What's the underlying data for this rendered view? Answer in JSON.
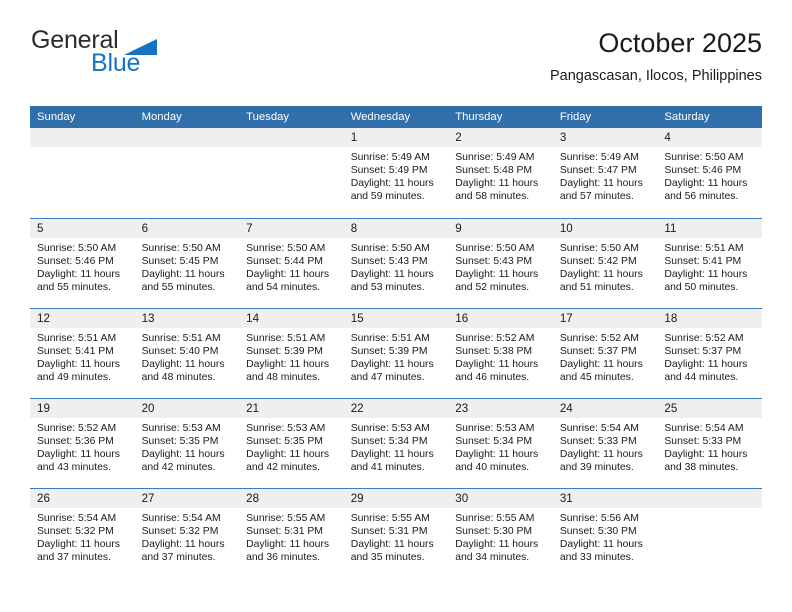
{
  "brand": {
    "name_part1": "General",
    "name_part2": "Blue",
    "accent_color": "#1573c1"
  },
  "header": {
    "title": "October 2025",
    "subtitle": "Pangascasan, Ilocos, Philippines"
  },
  "theme": {
    "header_row_bg": "#316fab",
    "daynum_bg": "#efefef",
    "row_divider": "#3b7ebf"
  },
  "calendar": {
    "weekdays": [
      "Sunday",
      "Monday",
      "Tuesday",
      "Wednesday",
      "Thursday",
      "Friday",
      "Saturday"
    ],
    "weeks": [
      [
        {
          "day": "",
          "sunrise": "",
          "sunset": "",
          "daylight_line1": "",
          "daylight_line2": "",
          "blank": true
        },
        {
          "day": "",
          "sunrise": "",
          "sunset": "",
          "daylight_line1": "",
          "daylight_line2": "",
          "blank": true
        },
        {
          "day": "",
          "sunrise": "",
          "sunset": "",
          "daylight_line1": "",
          "daylight_line2": "",
          "blank": true
        },
        {
          "day": "1",
          "sunrise": "Sunrise: 5:49 AM",
          "sunset": "Sunset: 5:49 PM",
          "daylight_line1": "Daylight: 11 hours",
          "daylight_line2": "and 59 minutes.",
          "blank": false
        },
        {
          "day": "2",
          "sunrise": "Sunrise: 5:49 AM",
          "sunset": "Sunset: 5:48 PM",
          "daylight_line1": "Daylight: 11 hours",
          "daylight_line2": "and 58 minutes.",
          "blank": false
        },
        {
          "day": "3",
          "sunrise": "Sunrise: 5:49 AM",
          "sunset": "Sunset: 5:47 PM",
          "daylight_line1": "Daylight: 11 hours",
          "daylight_line2": "and 57 minutes.",
          "blank": false
        },
        {
          "day": "4",
          "sunrise": "Sunrise: 5:50 AM",
          "sunset": "Sunset: 5:46 PM",
          "daylight_line1": "Daylight: 11 hours",
          "daylight_line2": "and 56 minutes.",
          "blank": false
        }
      ],
      [
        {
          "day": "5",
          "sunrise": "Sunrise: 5:50 AM",
          "sunset": "Sunset: 5:46 PM",
          "daylight_line1": "Daylight: 11 hours",
          "daylight_line2": "and 55 minutes.",
          "blank": false
        },
        {
          "day": "6",
          "sunrise": "Sunrise: 5:50 AM",
          "sunset": "Sunset: 5:45 PM",
          "daylight_line1": "Daylight: 11 hours",
          "daylight_line2": "and 55 minutes.",
          "blank": false
        },
        {
          "day": "7",
          "sunrise": "Sunrise: 5:50 AM",
          "sunset": "Sunset: 5:44 PM",
          "daylight_line1": "Daylight: 11 hours",
          "daylight_line2": "and 54 minutes.",
          "blank": false
        },
        {
          "day": "8",
          "sunrise": "Sunrise: 5:50 AM",
          "sunset": "Sunset: 5:43 PM",
          "daylight_line1": "Daylight: 11 hours",
          "daylight_line2": "and 53 minutes.",
          "blank": false
        },
        {
          "day": "9",
          "sunrise": "Sunrise: 5:50 AM",
          "sunset": "Sunset: 5:43 PM",
          "daylight_line1": "Daylight: 11 hours",
          "daylight_line2": "and 52 minutes.",
          "blank": false
        },
        {
          "day": "10",
          "sunrise": "Sunrise: 5:50 AM",
          "sunset": "Sunset: 5:42 PM",
          "daylight_line1": "Daylight: 11 hours",
          "daylight_line2": "and 51 minutes.",
          "blank": false
        },
        {
          "day": "11",
          "sunrise": "Sunrise: 5:51 AM",
          "sunset": "Sunset: 5:41 PM",
          "daylight_line1": "Daylight: 11 hours",
          "daylight_line2": "and 50 minutes.",
          "blank": false
        }
      ],
      [
        {
          "day": "12",
          "sunrise": "Sunrise: 5:51 AM",
          "sunset": "Sunset: 5:41 PM",
          "daylight_line1": "Daylight: 11 hours",
          "daylight_line2": "and 49 minutes.",
          "blank": false
        },
        {
          "day": "13",
          "sunrise": "Sunrise: 5:51 AM",
          "sunset": "Sunset: 5:40 PM",
          "daylight_line1": "Daylight: 11 hours",
          "daylight_line2": "and 48 minutes.",
          "blank": false
        },
        {
          "day": "14",
          "sunrise": "Sunrise: 5:51 AM",
          "sunset": "Sunset: 5:39 PM",
          "daylight_line1": "Daylight: 11 hours",
          "daylight_line2": "and 48 minutes.",
          "blank": false
        },
        {
          "day": "15",
          "sunrise": "Sunrise: 5:51 AM",
          "sunset": "Sunset: 5:39 PM",
          "daylight_line1": "Daylight: 11 hours",
          "daylight_line2": "and 47 minutes.",
          "blank": false
        },
        {
          "day": "16",
          "sunrise": "Sunrise: 5:52 AM",
          "sunset": "Sunset: 5:38 PM",
          "daylight_line1": "Daylight: 11 hours",
          "daylight_line2": "and 46 minutes.",
          "blank": false
        },
        {
          "day": "17",
          "sunrise": "Sunrise: 5:52 AM",
          "sunset": "Sunset: 5:37 PM",
          "daylight_line1": "Daylight: 11 hours",
          "daylight_line2": "and 45 minutes.",
          "blank": false
        },
        {
          "day": "18",
          "sunrise": "Sunrise: 5:52 AM",
          "sunset": "Sunset: 5:37 PM",
          "daylight_line1": "Daylight: 11 hours",
          "daylight_line2": "and 44 minutes.",
          "blank": false
        }
      ],
      [
        {
          "day": "19",
          "sunrise": "Sunrise: 5:52 AM",
          "sunset": "Sunset: 5:36 PM",
          "daylight_line1": "Daylight: 11 hours",
          "daylight_line2": "and 43 minutes.",
          "blank": false
        },
        {
          "day": "20",
          "sunrise": "Sunrise: 5:53 AM",
          "sunset": "Sunset: 5:35 PM",
          "daylight_line1": "Daylight: 11 hours",
          "daylight_line2": "and 42 minutes.",
          "blank": false
        },
        {
          "day": "21",
          "sunrise": "Sunrise: 5:53 AM",
          "sunset": "Sunset: 5:35 PM",
          "daylight_line1": "Daylight: 11 hours",
          "daylight_line2": "and 42 minutes.",
          "blank": false
        },
        {
          "day": "22",
          "sunrise": "Sunrise: 5:53 AM",
          "sunset": "Sunset: 5:34 PM",
          "daylight_line1": "Daylight: 11 hours",
          "daylight_line2": "and 41 minutes.",
          "blank": false
        },
        {
          "day": "23",
          "sunrise": "Sunrise: 5:53 AM",
          "sunset": "Sunset: 5:34 PM",
          "daylight_line1": "Daylight: 11 hours",
          "daylight_line2": "and 40 minutes.",
          "blank": false
        },
        {
          "day": "24",
          "sunrise": "Sunrise: 5:54 AM",
          "sunset": "Sunset: 5:33 PM",
          "daylight_line1": "Daylight: 11 hours",
          "daylight_line2": "and 39 minutes.",
          "blank": false
        },
        {
          "day": "25",
          "sunrise": "Sunrise: 5:54 AM",
          "sunset": "Sunset: 5:33 PM",
          "daylight_line1": "Daylight: 11 hours",
          "daylight_line2": "and 38 minutes.",
          "blank": false
        }
      ],
      [
        {
          "day": "26",
          "sunrise": "Sunrise: 5:54 AM",
          "sunset": "Sunset: 5:32 PM",
          "daylight_line1": "Daylight: 11 hours",
          "daylight_line2": "and 37 minutes.",
          "blank": false
        },
        {
          "day": "27",
          "sunrise": "Sunrise: 5:54 AM",
          "sunset": "Sunset: 5:32 PM",
          "daylight_line1": "Daylight: 11 hours",
          "daylight_line2": "and 37 minutes.",
          "blank": false
        },
        {
          "day": "28",
          "sunrise": "Sunrise: 5:55 AM",
          "sunset": "Sunset: 5:31 PM",
          "daylight_line1": "Daylight: 11 hours",
          "daylight_line2": "and 36 minutes.",
          "blank": false
        },
        {
          "day": "29",
          "sunrise": "Sunrise: 5:55 AM",
          "sunset": "Sunset: 5:31 PM",
          "daylight_line1": "Daylight: 11 hours",
          "daylight_line2": "and 35 minutes.",
          "blank": false
        },
        {
          "day": "30",
          "sunrise": "Sunrise: 5:55 AM",
          "sunset": "Sunset: 5:30 PM",
          "daylight_line1": "Daylight: 11 hours",
          "daylight_line2": "and 34 minutes.",
          "blank": false
        },
        {
          "day": "31",
          "sunrise": "Sunrise: 5:56 AM",
          "sunset": "Sunset: 5:30 PM",
          "daylight_line1": "Daylight: 11 hours",
          "daylight_line2": "and 33 minutes.",
          "blank": false
        },
        {
          "day": "",
          "sunrise": "",
          "sunset": "",
          "daylight_line1": "",
          "daylight_line2": "",
          "blank": true
        }
      ]
    ]
  }
}
